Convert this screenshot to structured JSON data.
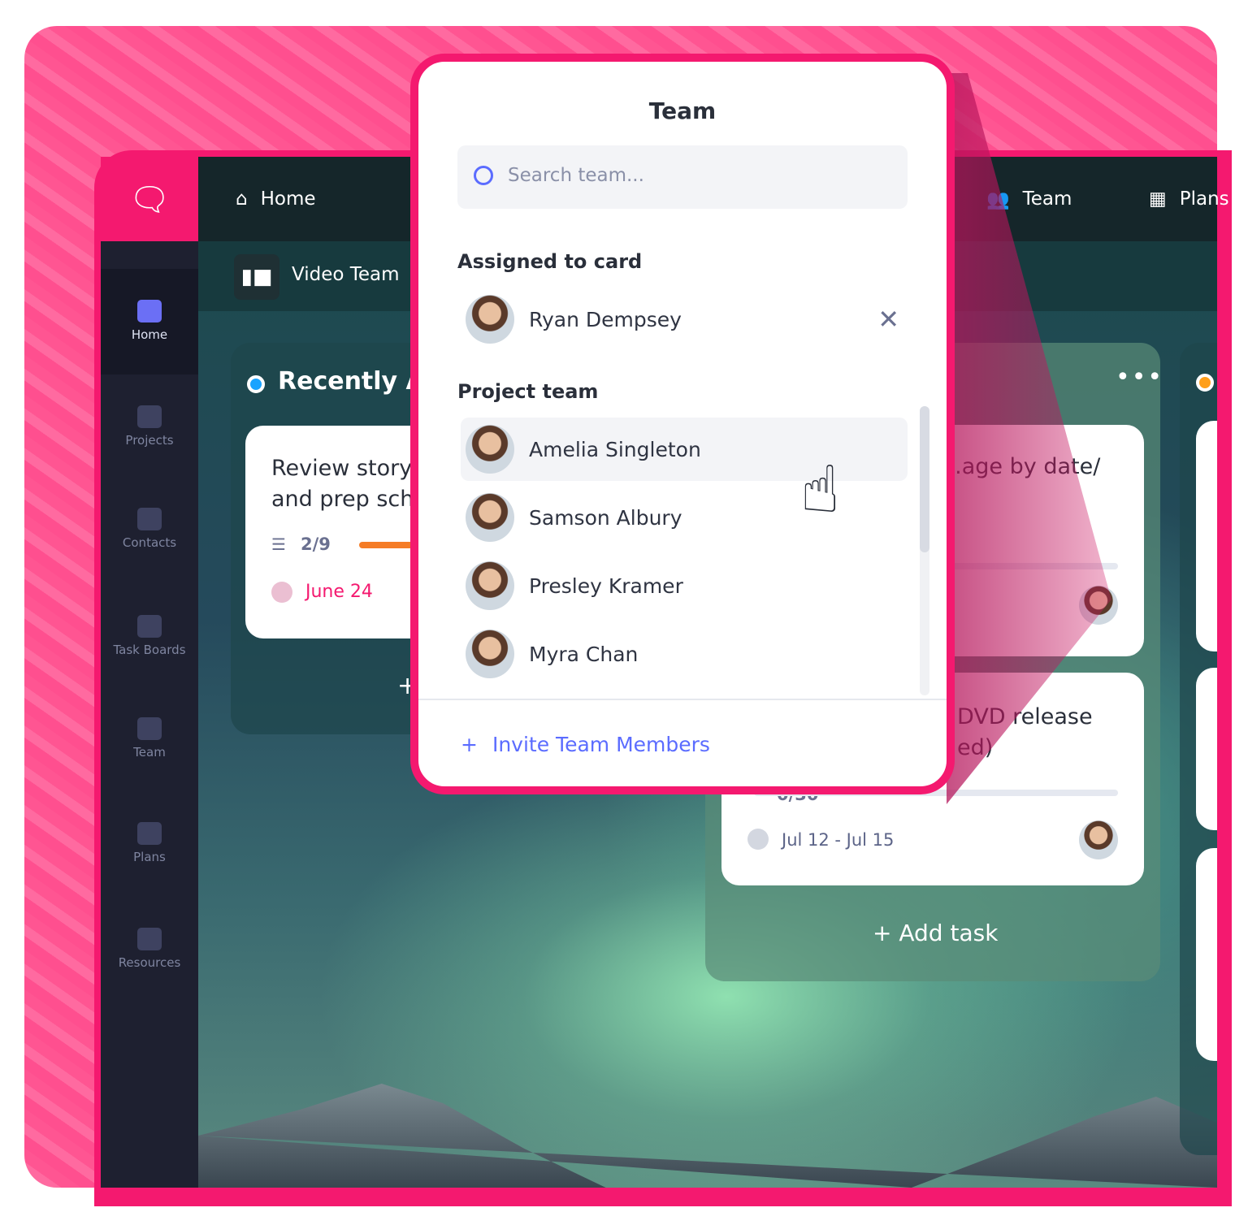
{
  "topnav": {
    "items": [
      {
        "label": "Home",
        "icon": "home-icon"
      },
      {
        "label": "Team",
        "icon": "team-icon"
      },
      {
        "label": "Plans",
        "icon": "plans-icon"
      }
    ]
  },
  "subheader": {
    "board": "Video Team"
  },
  "sidebar": {
    "items": [
      {
        "label": "Home",
        "active": true
      },
      {
        "label": "Projects"
      },
      {
        "label": "Contacts"
      },
      {
        "label": "Task Boards"
      },
      {
        "label": "Team"
      },
      {
        "label": "Plans"
      },
      {
        "label": "Resources"
      }
    ]
  },
  "column1": {
    "title": "Recently Assigned",
    "dot_color": "#1aa3ff",
    "card": {
      "title_l1": "Review story",
      "title_l2": "and prep sch",
      "checklist": "2/9",
      "progress": 0.22,
      "date": "June 24"
    },
    "add": "+"
  },
  "column2": {
    "card1": {
      "title": "...age by date/",
      "progress": 0
    },
    "card2": {
      "title_l1": "DVD release",
      "title_l2": "ed)",
      "checklist": "0/30",
      "date": "Jul 12 - Jul 15"
    },
    "add": "+ Add task"
  },
  "column3": {
    "dot_color": "#ff9f1a"
  },
  "popup": {
    "title": "Team",
    "search_placeholder": "Search team...",
    "assigned_heading": "Assigned to card",
    "assigned": [
      {
        "name": "Ryan Dempsey"
      }
    ],
    "project_heading": "Project team",
    "members": [
      {
        "name": "Amelia Singleton",
        "hovered": true
      },
      {
        "name": "Samson Albury"
      },
      {
        "name": "Presley Kramer"
      },
      {
        "name": "Myra Chan"
      }
    ],
    "invite": "Invite Team Members"
  },
  "colors": {
    "accent": "#f4196f",
    "link": "#5b6cff",
    "progress": "#f57c26"
  }
}
